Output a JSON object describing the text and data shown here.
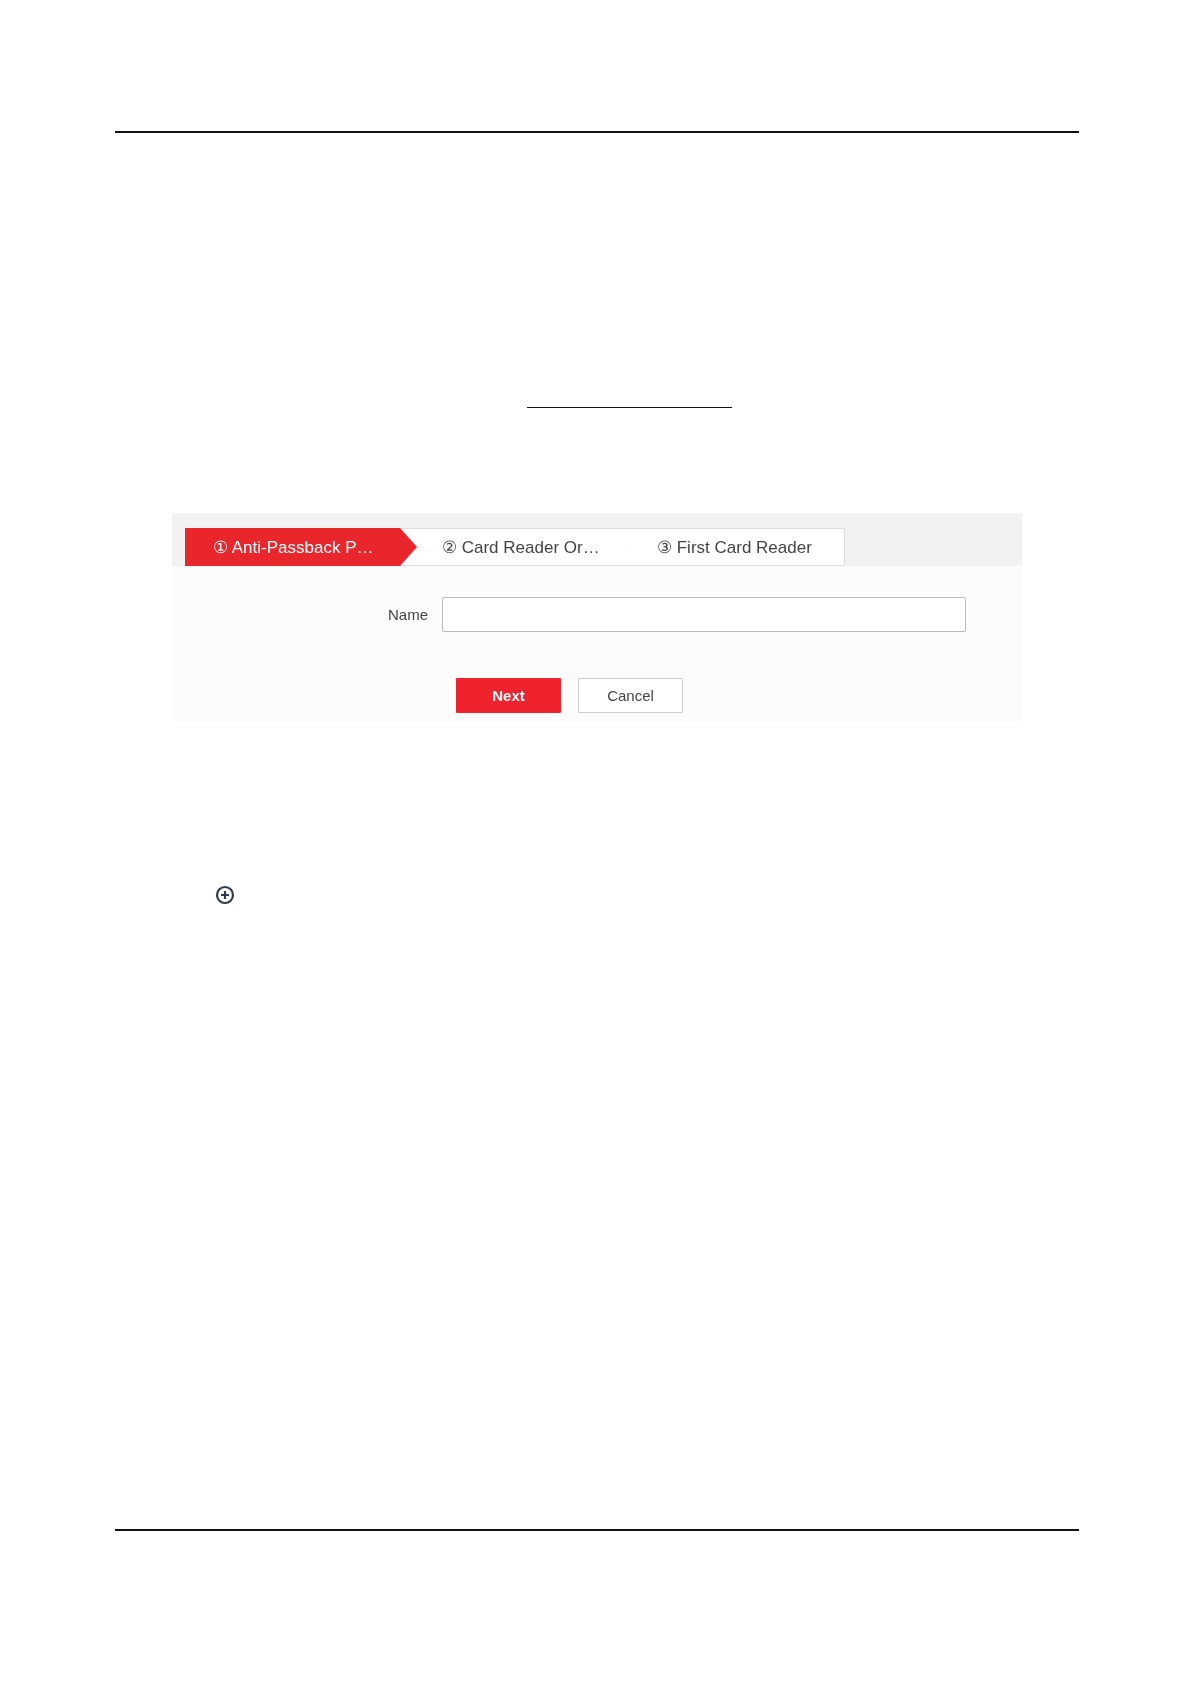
{
  "steps": [
    {
      "label": "① Anti-Passback P…",
      "selected": true
    },
    {
      "label": "② Card Reader Or…",
      "selected": false
    },
    {
      "label": "③ First Card Reader",
      "selected": false
    }
  ],
  "form": {
    "name_label": "Name"
  },
  "buttons": [
    {
      "label": "Next",
      "kind": "primary"
    },
    {
      "label": "Cancel",
      "kind": "secondary"
    }
  ]
}
